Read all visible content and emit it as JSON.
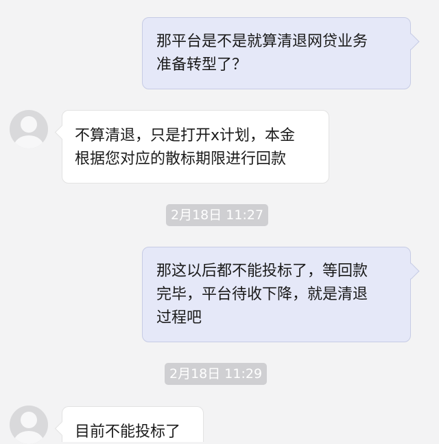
{
  "messages": [
    {
      "side": "out",
      "text": "那平台是不是就算清退网贷业务\n准备转型了？"
    },
    {
      "side": "in",
      "text": "不算清退，只是打开x计划，本金\n根据您对应的散标期限进行回款"
    },
    {
      "side": "out",
      "text": "那这以后都不能投标了，等回款\n完毕，平台待收下降，就是清退\n过程吧"
    },
    {
      "side": "in",
      "text": "目前不能投标了"
    }
  ],
  "timestamps": [
    {
      "text": "2月18日 11:27"
    },
    {
      "text": "2月18日 11:29"
    }
  ],
  "colors": {
    "background": "#f3f3f4",
    "outgoing_bubble": "#e5e8f8",
    "outgoing_border": "#c6cbe4",
    "incoming_bubble": "#ffffff",
    "timestamp_bg": "#cfcfd2"
  },
  "icons": {
    "avatar": "default-user-avatar-icon"
  }
}
